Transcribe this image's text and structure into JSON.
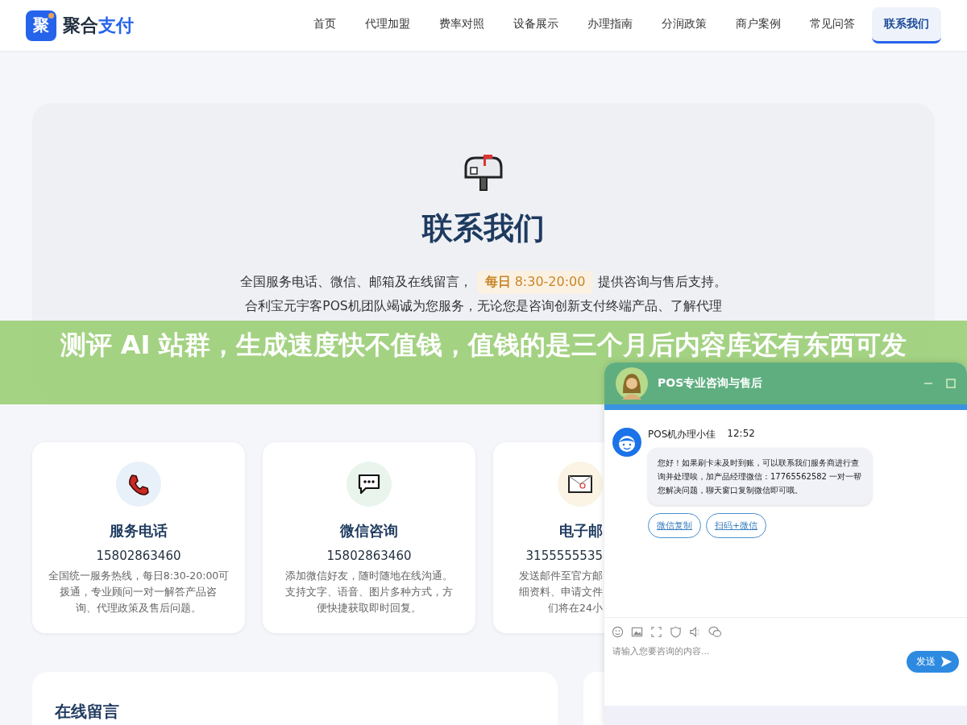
{
  "header": {
    "logo_char": "聚",
    "brand_dark": "聚合",
    "brand_accent": "支付",
    "nav": [
      {
        "label": "首页",
        "selected": false
      },
      {
        "label": "代理加盟",
        "selected": false
      },
      {
        "label": "费率对照",
        "selected": false
      },
      {
        "label": "设备展示",
        "selected": false
      },
      {
        "label": "办理指南",
        "selected": false
      },
      {
        "label": "分润政策",
        "selected": false
      },
      {
        "label": "商户案例",
        "selected": false
      },
      {
        "label": "常见问答",
        "selected": false
      },
      {
        "label": "联系我们",
        "selected": true
      }
    ]
  },
  "hero": {
    "title": "联系我们",
    "line_1_before": "全国服务电话、微信、邮箱及在线留言，",
    "hours": "**每日** 8:30-20:00",
    "line_1_after": "提供咨询与售后支持。",
    "line_2": "合利宝元宇客POS机团队竭诚为您服务，无论您是咨询创新支付终端产品、了解代理"
  },
  "banner": {
    "text": "测评 AI 站群，生成速度快不值钱，值钱的是三个月后内容库还有东西可发"
  },
  "cards": [
    {
      "kind": "phone",
      "title": "服务电话",
      "number": "15802863460",
      "desc": [
        "全国统一服务热线，每日8:30-20:00可",
        "拨通，专业顾问一对一解答产品咨",
        "询、代理政策及售后问题。"
      ]
    },
    {
      "kind": "chat",
      "title": "微信咨询",
      "number": "15802863460",
      "desc": [
        "添加微信好友，随时随地在线沟通。",
        "支持文字、语音、图片多种方式，方",
        "便快捷获取即时回复。"
      ]
    },
    {
      "kind": "mail",
      "title": "电子邮",
      "number": "3155555535",
      "desc": [
        "发送邮件至官方邮",
        "细资料、申请文件",
        "们将在24小"
      ]
    }
  ],
  "message_section": {
    "title": "在线留言"
  },
  "chat": {
    "title": "POS专业咨询与售后",
    "agent": "POS机办理小佳",
    "time": "12:52",
    "message": "您好！如果刷卡未及时到账，可以联系我们服务商进行查询并处理唉，加产品经理微信：17765562582 一对一帮您解决问题，聊天窗口复制微信即可哦。",
    "actions": [
      "微信复制",
      "扫码+微信"
    ],
    "placeholder": "请输入您要咨询的内容...",
    "send": "发送"
  }
}
